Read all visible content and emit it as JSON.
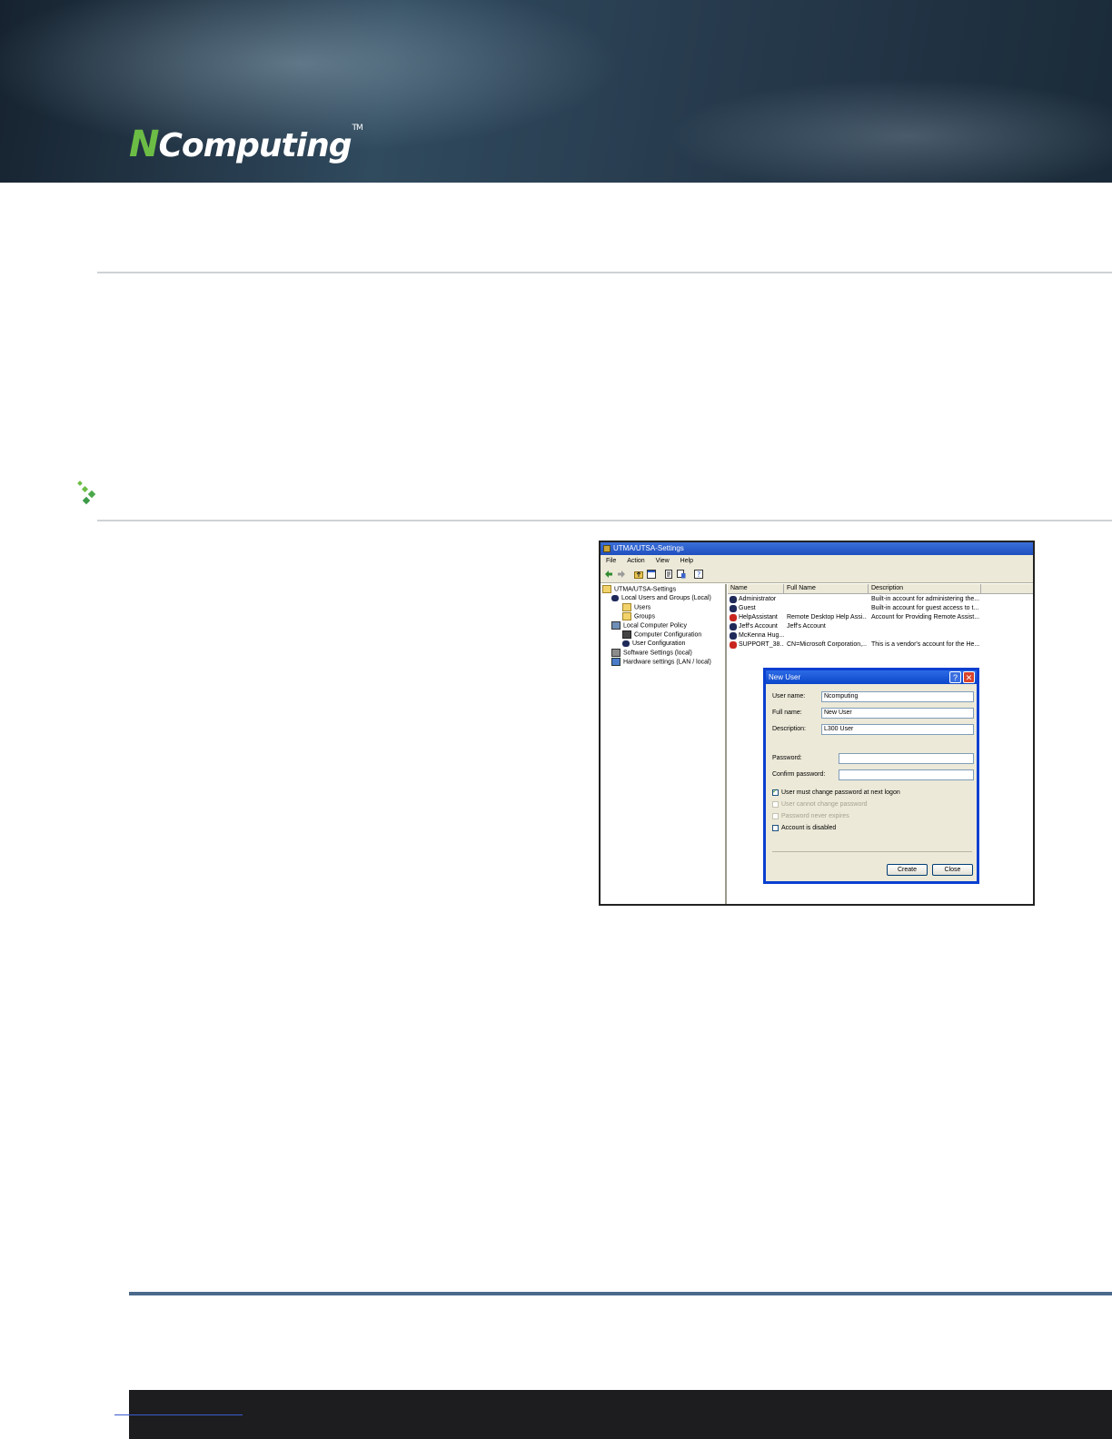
{
  "header": {
    "logo_initial": "N",
    "logo_rest": "Computing",
    "logo_tm": "TM"
  },
  "screenshot": {
    "window_title": "UTMA/UTSA-Settings",
    "menu": [
      "File",
      "Action",
      "View",
      "Help"
    ],
    "tree": [
      "UTMA/UTSA-Settings",
      "Local Users and Groups (Local)",
      "Users",
      "Groups",
      "Local Computer Policy",
      "Computer Configuration",
      "User Configuration",
      "Software Settings (local)",
      "Hardware settings (LAN / local)"
    ],
    "columns": [
      "Name",
      "Full Name",
      "Description"
    ],
    "rows": [
      {
        "name": "Administrator",
        "full_name": "",
        "description": "Built-in account for administering the..."
      },
      {
        "name": "Guest",
        "full_name": "",
        "description": "Built-in account for guest access to t..."
      },
      {
        "name": "HelpAssistant",
        "full_name": "Remote Desktop Help Assi...",
        "description": "Account for Providing Remote Assist..."
      },
      {
        "name": "Jeff's Account",
        "full_name": "Jeff's Account",
        "description": ""
      },
      {
        "name": "McKenna Hug...",
        "full_name": "",
        "description": ""
      },
      {
        "name": "SUPPORT_38...",
        "full_name": "CN=Microsoft Corporation,...",
        "description": "This is a vendor's account for the He..."
      }
    ],
    "dialog": {
      "title": "New User",
      "help_glyph": "?",
      "close_glyph": "✕",
      "user_name_label": "User name:",
      "user_name_value": "Ncomputing",
      "full_name_label": "Full name:",
      "full_name_value": "New User",
      "description_label": "Description:",
      "description_value": "L300 User",
      "password_label": "Password:",
      "confirm_label": "Confirm password:",
      "check_must_change": "User must change password at next logon",
      "check_cannot_change": "User cannot change password",
      "check_never_expires": "Password never expires",
      "check_disabled": "Account is disabled",
      "create_button": "Create",
      "close_button": "Close"
    }
  },
  "colors": {
    "brand_green": "#6cbd45",
    "banner_dark": "#1a2a38",
    "rule_gray": "#cfd2d4",
    "footer_rule": "#4a6a8c"
  }
}
